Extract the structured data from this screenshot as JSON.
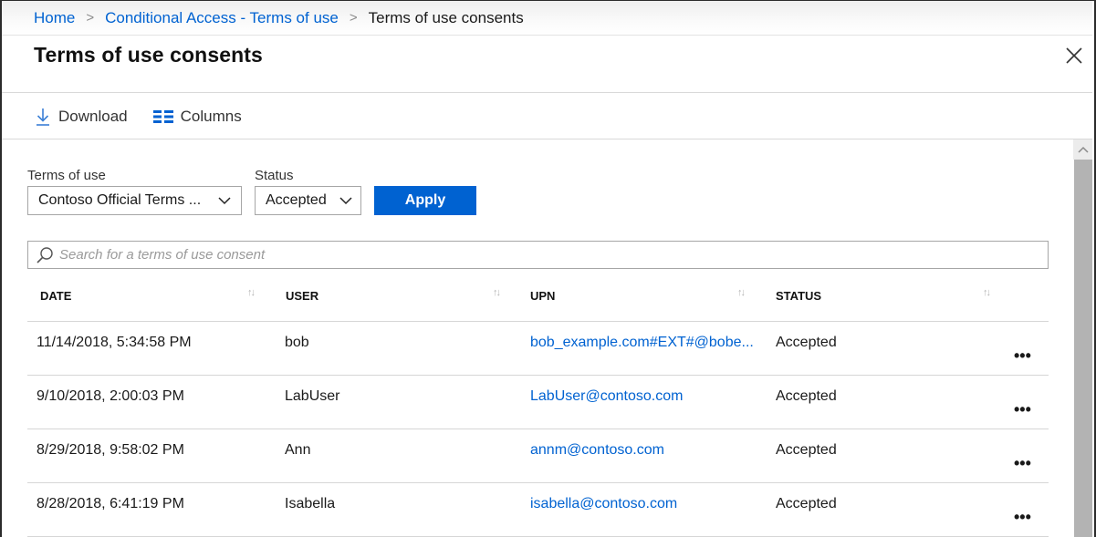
{
  "breadcrumb": {
    "items": [
      {
        "label": "Home",
        "link": true
      },
      {
        "label": "Conditional Access - Terms of use",
        "link": true
      },
      {
        "label": "Terms of use consents",
        "link": false
      }
    ],
    "separator": ">"
  },
  "header": {
    "title": "Terms of use consents",
    "close_icon": "close-icon"
  },
  "toolbar": {
    "download_label": "Download",
    "download_icon": "download-icon",
    "columns_label": "Columns",
    "columns_icon": "columns-icon"
  },
  "filters": {
    "terms_label": "Terms of use",
    "terms_value": "Contoso Official Terms ...",
    "status_label": "Status",
    "status_value": "Accepted",
    "apply_label": "Apply"
  },
  "search": {
    "placeholder": "Search for a terms of use consent",
    "value": ""
  },
  "table": {
    "columns": [
      "DATE",
      "USER",
      "UPN",
      "STATUS"
    ],
    "rows": [
      {
        "date": "11/14/2018, 5:34:58 PM",
        "user": "bob",
        "upn": "bob_example.com#EXT#@bobe...",
        "status": "Accepted"
      },
      {
        "date": "9/10/2018, 2:00:03 PM",
        "user": "LabUser",
        "upn": "LabUser@contoso.com",
        "status": "Accepted"
      },
      {
        "date": "8/29/2018, 9:58:02 PM",
        "user": "Ann",
        "upn": "annm@contoso.com",
        "status": "Accepted"
      },
      {
        "date": "8/28/2018, 6:41:19 PM",
        "user": "Isabella",
        "upn": "isabella@contoso.com",
        "status": "Accepted"
      }
    ],
    "more_label": "•••",
    "sort_label": "↑↓"
  },
  "colors": {
    "accent": "#0062d1",
    "scrollbar_thumb": "#b3b3b3"
  }
}
